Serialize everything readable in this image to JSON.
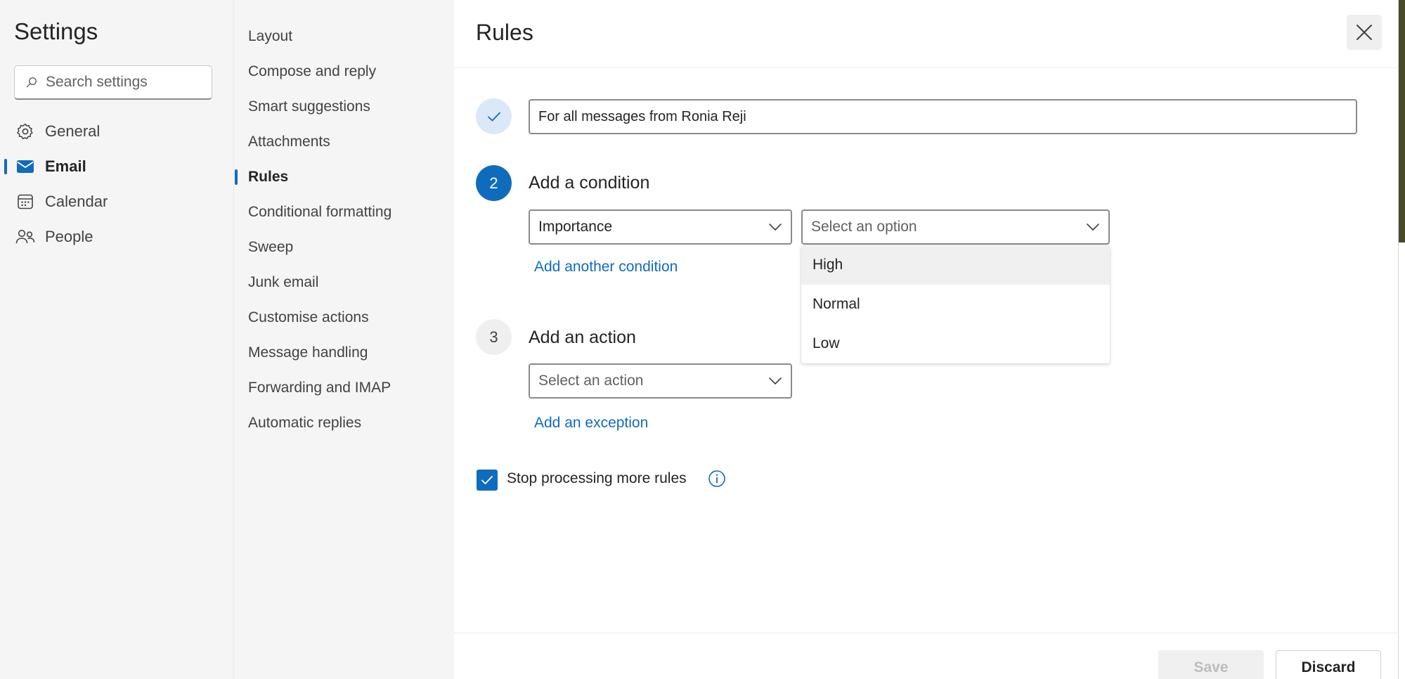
{
  "settings": {
    "title": "Settings",
    "search_placeholder": "Search settings",
    "categories": [
      {
        "label": "General",
        "icon": "gear-icon"
      },
      {
        "label": "Email",
        "icon": "mail-icon",
        "active": true
      },
      {
        "label": "Calendar",
        "icon": "calendar-icon"
      },
      {
        "label": "People",
        "icon": "people-icon"
      }
    ]
  },
  "email_nav": {
    "items": [
      {
        "label": "Layout"
      },
      {
        "label": "Compose and reply"
      },
      {
        "label": "Smart suggestions"
      },
      {
        "label": "Attachments"
      },
      {
        "label": "Rules",
        "active": true
      },
      {
        "label": "Conditional formatting"
      },
      {
        "label": "Sweep"
      },
      {
        "label": "Junk email"
      },
      {
        "label": "Customise actions"
      },
      {
        "label": "Message handling"
      },
      {
        "label": "Forwarding and IMAP"
      },
      {
        "label": "Automatic replies"
      }
    ]
  },
  "rules": {
    "title": "Rules",
    "rule_name": "For all messages from Ronia Reji",
    "step2": {
      "number": "2",
      "label": "Add a condition",
      "condition_value": "Importance",
      "option_placeholder": "Select an option",
      "add_link": "Add another condition"
    },
    "dropdown_options": [
      "High",
      "Normal",
      "Low"
    ],
    "step3": {
      "number": "3",
      "label": "Add an action",
      "action_placeholder": "Select an action",
      "add_link": "Add an exception"
    },
    "stop_processing": {
      "label": "Stop processing more rules",
      "checked": true
    },
    "footer": {
      "save_label": "Save",
      "discard_label": "Discard"
    }
  },
  "colors": {
    "accent": "#0f6cbd",
    "sidebar_bg": "#f5f5f5"
  }
}
